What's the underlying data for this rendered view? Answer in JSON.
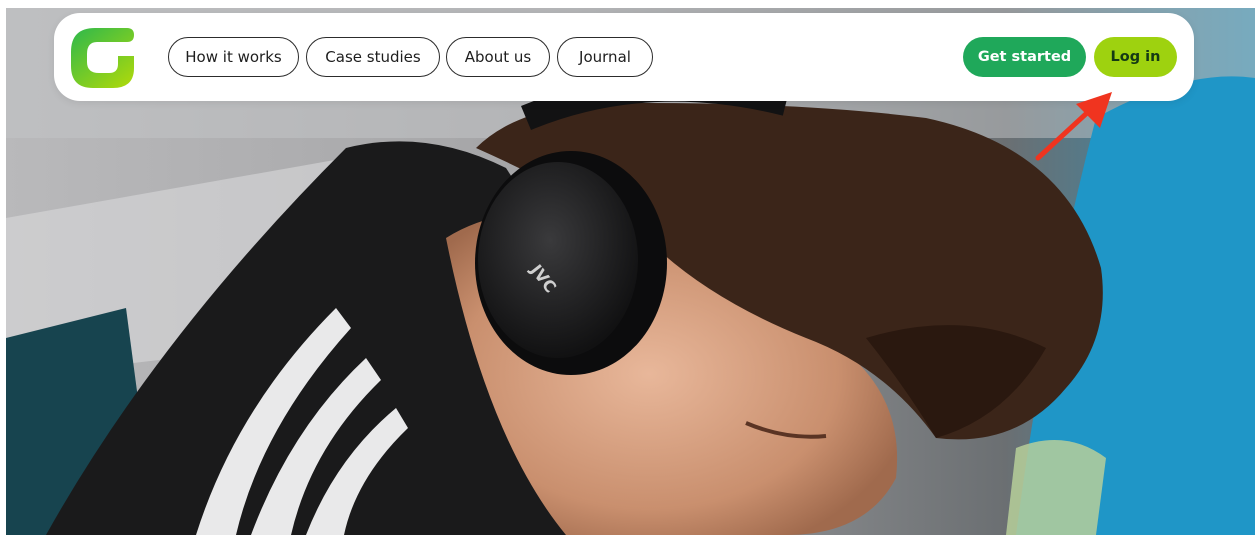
{
  "brand": {
    "logo_icon": "brand-g-logo-icon",
    "gradient_top": "#2db84c",
    "gradient_bottom": "#a6d70f"
  },
  "nav": {
    "items": [
      {
        "label": "How it works"
      },
      {
        "label": "Case studies"
      },
      {
        "label": "About us"
      },
      {
        "label": "Journal"
      }
    ],
    "get_started_label": "Get started",
    "login_label": "Log in"
  },
  "colors": {
    "primary_green": "#1fa85a",
    "lime": "#9ed20f",
    "annotation_arrow": "#f0341f"
  },
  "hero": {
    "image": "photo-of-boy-with-headphones",
    "headphone_brand": "JVC"
  },
  "annotation": {
    "icon": "red-arrow-annotation-icon"
  }
}
